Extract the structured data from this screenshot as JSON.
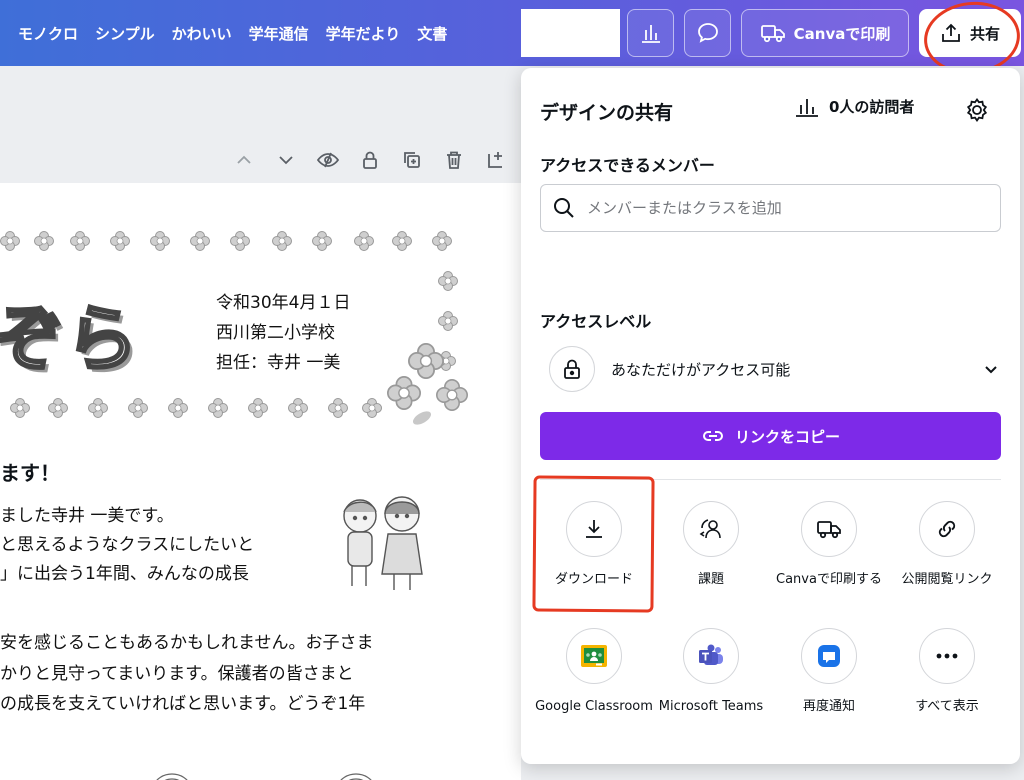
{
  "nav": {
    "items": [
      "モノクロ",
      "シンプル",
      "かわいい",
      "学年通信",
      "学年だより",
      "文書"
    ]
  },
  "topbar": {
    "print_label": "Canvaで印刷",
    "share_label": "共有"
  },
  "document": {
    "title": "ぞら",
    "info_lines": [
      "令和30年4月１日",
      "西川第二小学校",
      "担任：寺井 一美"
    ],
    "heading": "ます！",
    "paragraphs": [
      "ました寺井 一美です。",
      "と思えるようなクラスにしたいと",
      "」に出会う1年間、みんなの成長",
      "安を感じることもあるかもしれません。お子さま",
      "かりと見守ってまいります。保護者の皆さまと",
      "の成長を支えていければと思います。どうぞ1年"
    ]
  },
  "share_panel": {
    "title": "デザインの共有",
    "visitors": "0人の訪問者",
    "access_members_label": "アクセスできるメンバー",
    "search_placeholder": "メンバーまたはクラスを追加",
    "access_level_label": "アクセスレベル",
    "access_level_value": "あなただけがアクセス可能",
    "copy_link_label": "リンクをコピー",
    "options": [
      {
        "label": "ダウンロード",
        "icon": "download-icon"
      },
      {
        "label": "課題",
        "icon": "assignment-icon"
      },
      {
        "label": "Canvaで印刷する",
        "icon": "truck-icon"
      },
      {
        "label": "公開閲覧リンク",
        "icon": "link-icon"
      },
      {
        "label": "Google Classroom",
        "icon": "google-classroom-icon"
      },
      {
        "label": "Microsoft Teams",
        "icon": "microsoft-teams-icon"
      },
      {
        "label": "再度通知",
        "icon": "notify-icon"
      },
      {
        "label": "すべて表示",
        "icon": "more-icon"
      }
    ]
  },
  "colors": {
    "accent": "#7d2ae8",
    "highlight": "#e63a22",
    "topbar_start": "#3f6fd8",
    "topbar_end": "#7a55e0"
  }
}
